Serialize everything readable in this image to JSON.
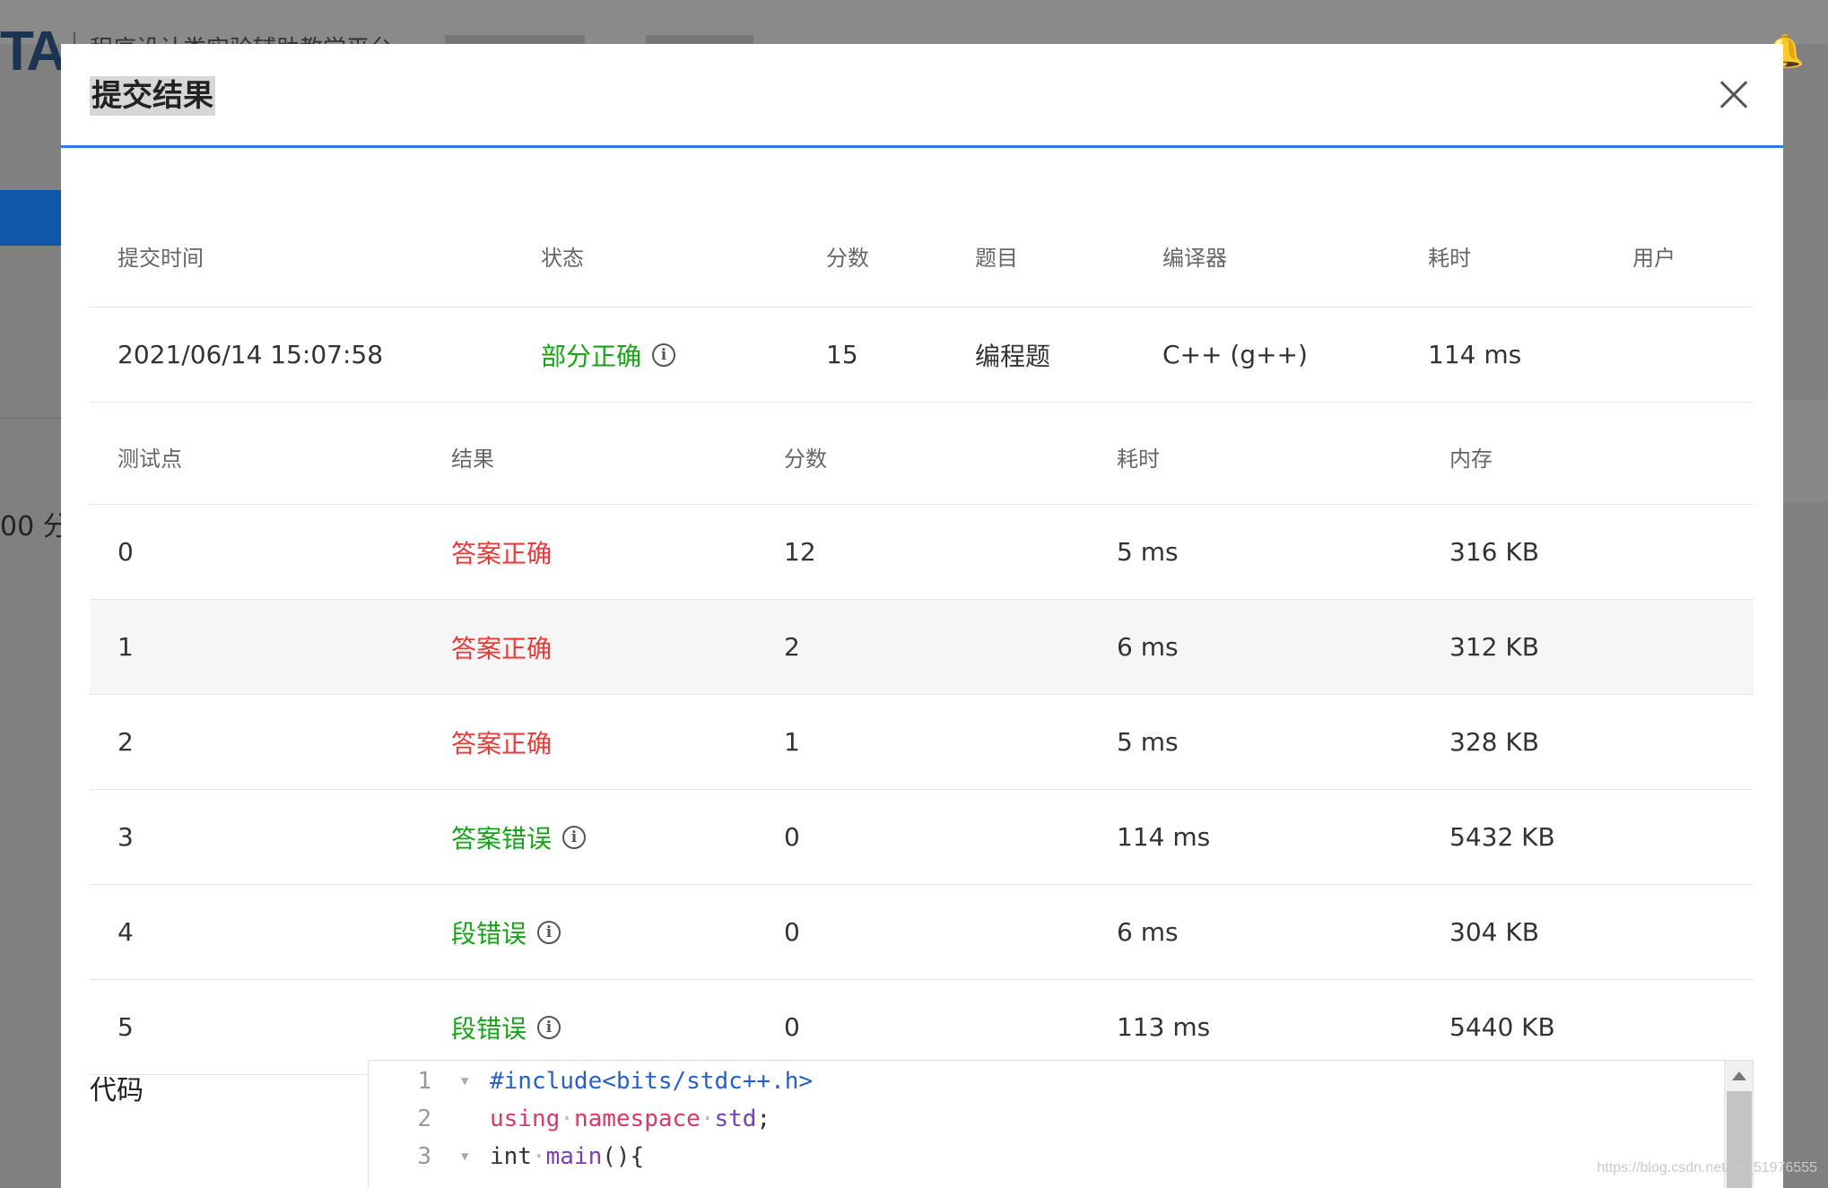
{
  "background": {
    "logo": "TA",
    "site_title": "程序设计类实验辅助教学平台",
    "score_fragment": "00 分",
    "watermark": "https://blog.csdn.net/qq_51976555"
  },
  "modal": {
    "title": "提交结果"
  },
  "summary": {
    "headers": [
      "提交时间",
      "状态",
      "分数",
      "题目",
      "编译器",
      "耗时",
      "用户"
    ],
    "row": {
      "time": "2021/06/14 15:07:58",
      "status": "部分正确",
      "score": "15",
      "problem": "编程题",
      "compiler": "C++ (g++)",
      "elapsed": "114 ms",
      "user": ""
    }
  },
  "tests": {
    "headers": [
      "测试点",
      "结果",
      "分数",
      "耗时",
      "内存"
    ],
    "rows": [
      {
        "id": "0",
        "result": "答案正确",
        "score": "12",
        "time": "5 ms",
        "memory": "316 KB"
      },
      {
        "id": "1",
        "result": "答案正确",
        "score": "2",
        "time": "6 ms",
        "memory": "312 KB"
      },
      {
        "id": "2",
        "result": "答案正确",
        "score": "1",
        "time": "5 ms",
        "memory": "328 KB"
      },
      {
        "id": "3",
        "result": "答案错误",
        "score": "0",
        "time": "114 ms",
        "memory": "5432 KB"
      },
      {
        "id": "4",
        "result": "段错误",
        "score": "0",
        "time": "6 ms",
        "memory": "304 KB"
      },
      {
        "id": "5",
        "result": "段错误",
        "score": "0",
        "time": "113 ms",
        "memory": "5440 KB"
      }
    ]
  },
  "code": {
    "label": "代码",
    "lines": [
      {
        "no": "1",
        "p1": "#include<bits/stdc++.h>"
      },
      {
        "no": "2",
        "p1": "using",
        "p2": "namespace",
        "p3": "std",
        "p4": ";"
      },
      {
        "no": "3",
        "p1": "int",
        "p2": "main",
        "p3": "(){"
      }
    ]
  },
  "colors": {
    "accent_blue": "#2d7be0",
    "correct_red": "#ea3a3a",
    "status_green": "#17a317"
  },
  "icons": [
    "info-icon",
    "close-icon",
    "bell-icon",
    "fold-arrow-icon"
  ]
}
